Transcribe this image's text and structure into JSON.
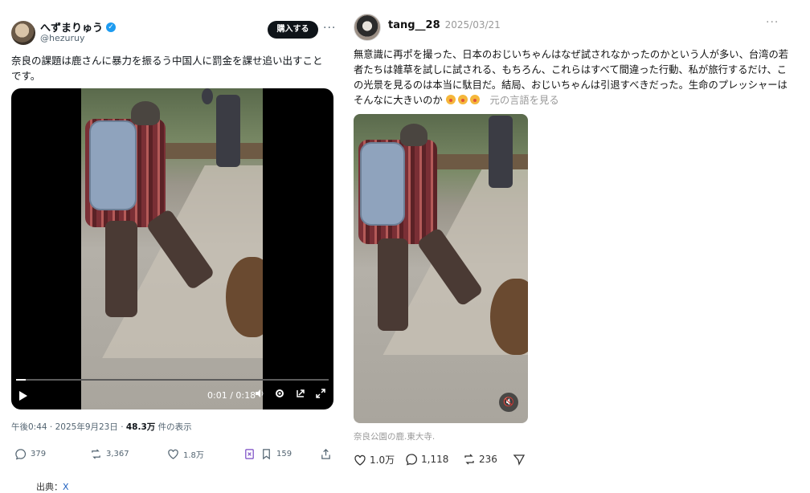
{
  "left_post": {
    "display_name": "へずまりゅう",
    "handle": "@hezuruy",
    "buy_button": "購入する",
    "more": "···",
    "text": "奈良の課題は鹿さんに暴力を振るう中国人に罰金を課せ追い出すことです。",
    "video": {
      "time": "0:01 / 0:18",
      "progress": 0.03
    },
    "meta": {
      "timestamp": "午後0:44 · 2025年9月23日 · ",
      "views": "48.3万",
      "views_suffix": " 件の表示"
    },
    "actions": {
      "replies": "379",
      "reposts": "3,367",
      "likes": "1.8万",
      "bookmarks": "159"
    }
  },
  "right_post": {
    "username": "tang__28",
    "date": "2025/03/21",
    "more": "···",
    "text": "無意識に再ポを撮った、日本のおじいちゃんはなぜ試されなかったのかという人が多い、台湾の若者たちは雑草を試しに試される、もちろん、これらはすべて間違った行動、私が旅行するだけ、この光景を見るのは本当に駄目だ。結局、おじいちゃんは引退すべきだった。生命のプレッシャーはそんなに大きいのか",
    "see_original": "元の言語を見る",
    "caption": "奈良公園の鹿.東大寺.",
    "actions": {
      "likes": "1.0万",
      "comments": "1,118",
      "reposts": "236"
    }
  },
  "source": {
    "label": "出典：",
    "value": "X"
  },
  "colors": {
    "verified": "#1d9bf0",
    "buy_button_bg": "#0f1419",
    "secondary_text": "#536471"
  }
}
